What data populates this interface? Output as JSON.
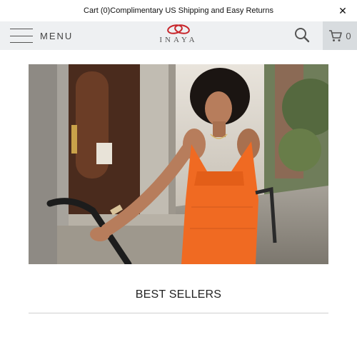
{
  "announcement": {
    "text": "Cart (0)Complimentary US Shipping and Easy Returns",
    "close_icon": "close-icon"
  },
  "header": {
    "menu_label": "MENU",
    "menu_icon": "hamburger-icon",
    "logo_text": "INAYA",
    "search_icon": "search-icon",
    "cart_icon": "cart-icon",
    "cart_count": "0"
  },
  "hero": {
    "image": "woman-in-orange-dress-on-city-street"
  },
  "best_sellers": {
    "title": "BEST SELLERS"
  },
  "colors": {
    "header_bg": "#eef0f2",
    "cart_bg": "#d8dcdf",
    "logo_red": "#c8262b",
    "dress_orange": "#f06a22"
  }
}
